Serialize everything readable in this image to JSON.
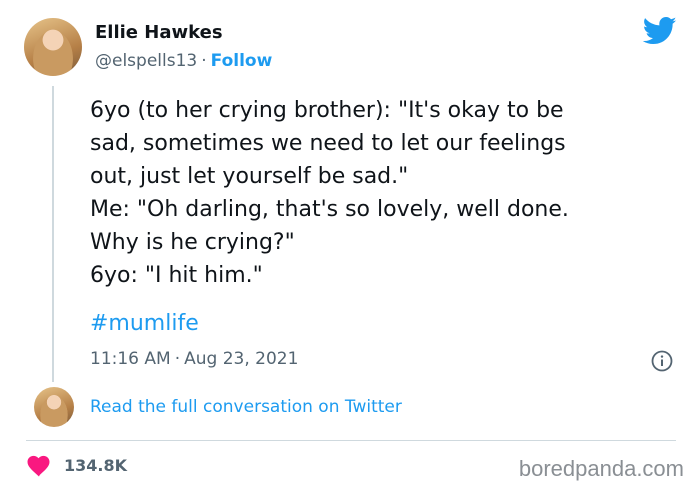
{
  "user": {
    "name": "Ellie Hawkes",
    "handle": "@elspells13",
    "separator": "·",
    "follow_label": "Follow"
  },
  "tweet": {
    "lines": [
      "6yo (to her crying brother): \"It's okay to be",
      "sad, sometimes we need to let our feelings",
      "out, just let yourself be sad.\"",
      "Me: \"Oh darling, that's so lovely, well done.",
      "Why is he crying?\"",
      "6yo: \"I hit him.\""
    ],
    "hashtag": "#mumlife",
    "time": "11:16 AM",
    "separator": "·",
    "date": "Aug 23, 2021"
  },
  "conversation_link": "Read the full conversation on Twitter",
  "likes": "134.8K",
  "watermark": "boredpanda.com",
  "colors": {
    "accent": "#1d9bf0",
    "heart": "#f91880",
    "text": "#0f1419",
    "secondary": "#536471"
  },
  "icons": [
    "twitter-bird-icon",
    "info-icon",
    "heart-icon"
  ]
}
